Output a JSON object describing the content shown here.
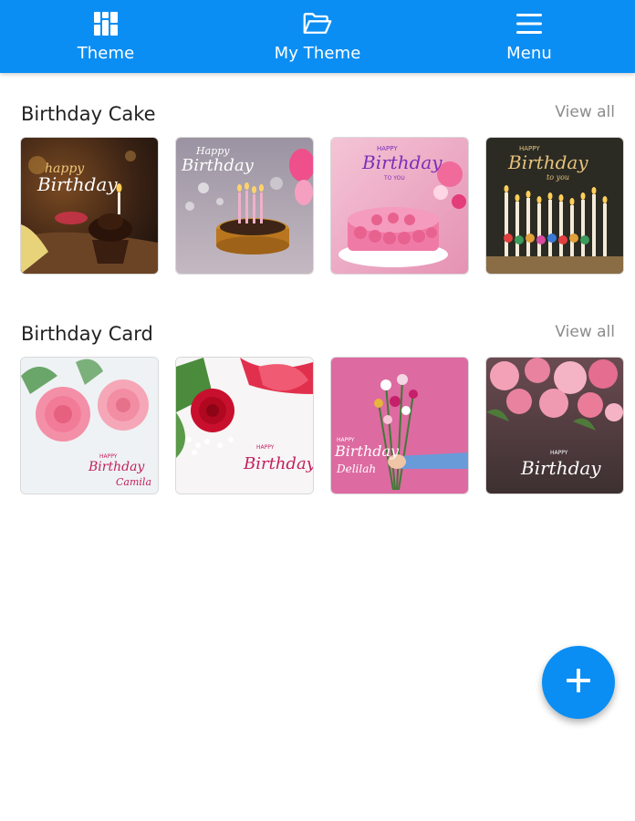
{
  "nav": {
    "tabs": [
      {
        "label": "Theme",
        "icon": "grid-icon"
      },
      {
        "label": "My Theme",
        "icon": "folder-open-icon"
      },
      {
        "label": "Menu",
        "icon": "hamburger-menu-icon"
      }
    ],
    "bar_color": "#0b8ef3"
  },
  "sections": [
    {
      "title": "Birthday Cake",
      "view_all": "View all",
      "items": [
        {
          "caption": "Happy Birthday",
          "theme": "chocolate-cupcake-candle"
        },
        {
          "caption": "Happy Birthday",
          "theme": "cake-with-candles-balloons"
        },
        {
          "caption": "HAPPY Birthday TO YOU",
          "theme": "pink-rose-cake"
        },
        {
          "caption": "HAPPY Birthday to you",
          "theme": "candles-happy-birthday"
        }
      ]
    },
    {
      "title": "Birthday Card",
      "view_all": "View all",
      "items": [
        {
          "caption": "HAPPY Birthday Camila",
          "theme": "pink-roses"
        },
        {
          "caption": "HAPPY Birthday",
          "theme": "red-rose-ribbon"
        },
        {
          "caption": "HAPPY Birthday Delilah",
          "theme": "flower-bouquet-hand"
        },
        {
          "caption": "HAPPY Birthday",
          "theme": "pink-roses-dark"
        }
      ]
    }
  ],
  "fab": {
    "icon": "plus-icon",
    "color": "#0b8ef3"
  }
}
